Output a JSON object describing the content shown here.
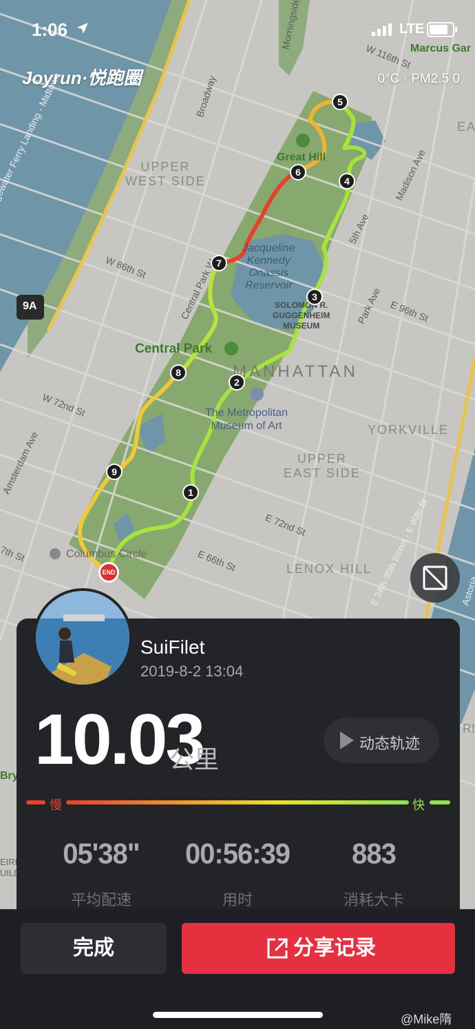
{
  "status_bar": {
    "time": "1:06",
    "carrier": "LTE"
  },
  "brand": {
    "logo_text": "Joyrun·悦跑圈"
  },
  "weather": {
    "text": "0°C · PM2.5 0"
  },
  "map": {
    "labels": {
      "upper_west_side": "UPPER\nWEST SIDE",
      "upper_east_side": "UPPER\nEAST SIDE",
      "manhattan": "MANHATTAN",
      "yorkville": "YORKVILLE",
      "lenox_hill": "LENOX HILL",
      "central_park": "Central Park",
      "great_hill": "Great Hill",
      "reservoir": "Jacqueline\nKennedy\nOnassis\nReservoir",
      "guggenheim": "SOLOMON R.\nGUGGENHEIM\nMUSEUM",
      "met": "The Metropolitan\nMuseum of Art",
      "columbus_circle": "Columbus Circle",
      "marcus_garvey": "Marcus Gar",
      "w116": "W 116th St",
      "w86": "W 86th St",
      "w72": "W 72nd St",
      "e96": "E 96th St",
      "e72": "E 72nd St",
      "e66": "E 66th St",
      "w7": "7th St",
      "broadway": "Broadway",
      "cpw": "Central Park W",
      "fifth": "5th Ave",
      "madison": "Madison Ave",
      "park": "Park Ave",
      "amsterdam": "Amsterdam Ave",
      "morningside": "Morningside",
      "edgewater": "Edgewater Ferry Landing - Midtown",
      "fdr": "E 34th-35th Street - E 90th St",
      "astoria": "Astoria",
      "route_9a": "9A",
      "ea": "EA",
      "bry": "Bry",
      "eire": "EIRE\nUILD",
      "ri": "RI"
    },
    "km_markers": [
      "1",
      "2",
      "3",
      "4",
      "5",
      "6",
      "7",
      "8",
      "9"
    ],
    "end_marker": "END",
    "route_speed_colors": {
      "slow": "#e8412c",
      "mid": "#f2b233",
      "fast": "#a6e33d"
    }
  },
  "profile": {
    "username": "SuiFilet",
    "datetime": "2019-8-2 13:04"
  },
  "run": {
    "distance": "10.03",
    "unit": "公里",
    "replay_label": "动态轨迹"
  },
  "pace_legend": {
    "slow": "慢",
    "fast": "快"
  },
  "stats": [
    {
      "value": "05'38\"",
      "label": "平均配速"
    },
    {
      "value": "00:56:39",
      "label": "用时"
    },
    {
      "value": "883",
      "label": "消耗大卡"
    }
  ],
  "actions": {
    "done": "完成",
    "share": "分享记录"
  },
  "watermark": "@Mike隋"
}
